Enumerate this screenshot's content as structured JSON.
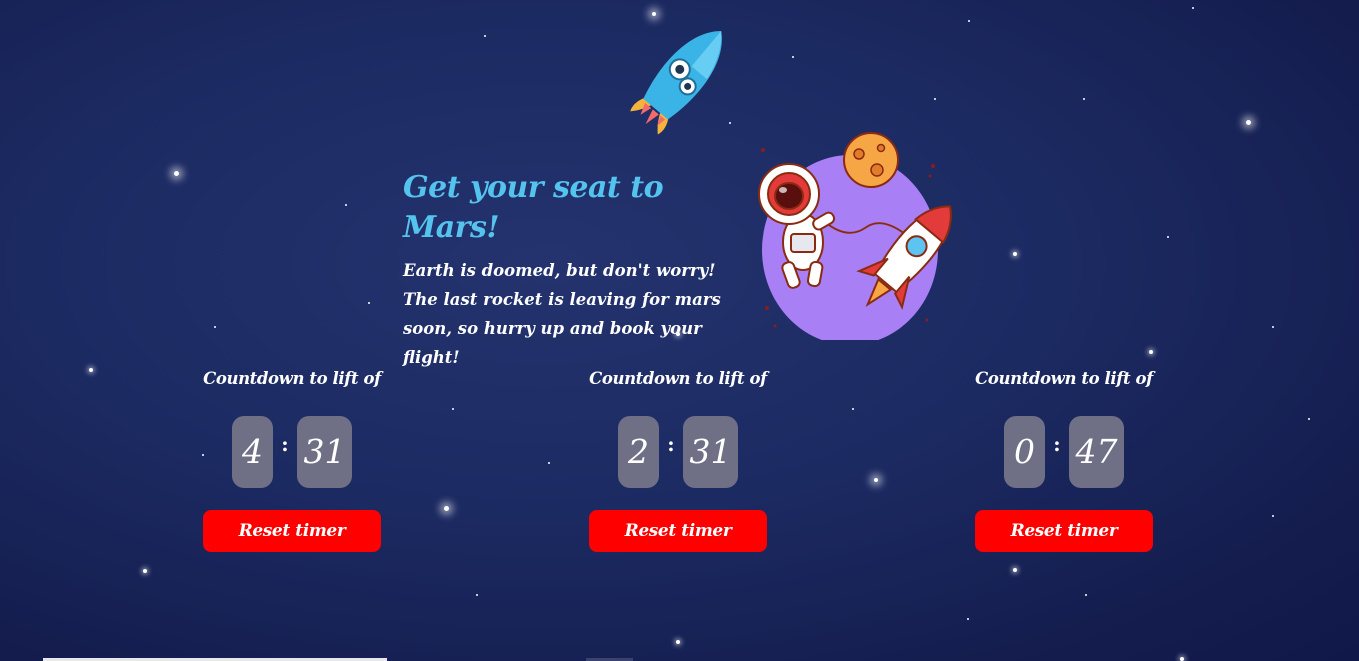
{
  "hero": {
    "title": "Get your seat to Mars!",
    "description": "Earth is doomed, but don't worry! The last rocket is leaving for mars soon, so hurry up and book your flight!"
  },
  "timers": [
    {
      "label": "Countdown to lift of",
      "minutes": "4",
      "seconds": "31",
      "button": "Reset timer"
    },
    {
      "label": "Countdown to lift of",
      "minutes": "2",
      "seconds": "31",
      "button": "Reset timer"
    },
    {
      "label": "Countdown to lift of",
      "minutes": "0",
      "seconds": "47",
      "button": "Reset timer"
    }
  ],
  "colors": {
    "background": "#1c2a62",
    "title": "#54c4ee",
    "digit_box": "#6f6f86",
    "button": "#fe0000",
    "planet": "#a97ff6"
  },
  "icons": [
    "rocket-icon",
    "astronaut-illustration",
    "planet-icon"
  ]
}
